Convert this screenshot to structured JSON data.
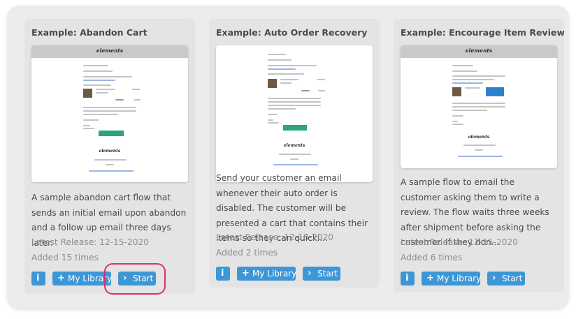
{
  "cards": [
    {
      "title": "Example: Abandon Cart",
      "thumb_logo": "elements",
      "description": "A sample abandon cart flow that sends an initial email upon abandon and a follow up email three days later.",
      "release": "Latest Release: 12-15-2020",
      "added": "Added 15 times"
    },
    {
      "title": "Example: Auto Order Recovery",
      "thumb_logo": "elements",
      "description": "Send your customer an email whenever their auto order is disabled. The customer will be presented a cart that contains their items so they can quickl...",
      "release": "Latest Release: 12-18-2020",
      "added": "Added 2 times"
    },
    {
      "title": "Example: Encourage Item Review",
      "thumb_logo": "elements",
      "description": "A sample flow to email the customer asking them to write a review. The flow waits three weeks after shipment before asking the customer. If they don...",
      "release": "Latest Release: 12-15-2020",
      "added": "Added 6 times"
    }
  ],
  "buttons": {
    "info_icon": "i",
    "library_icon": "+",
    "library_label": "My Library",
    "start_icon": "›",
    "start_label": "Start"
  },
  "colors": {
    "button": "#3d96d6",
    "highlight": "#de2d79",
    "card": "#e4e4e4",
    "board": "#ececec"
  }
}
